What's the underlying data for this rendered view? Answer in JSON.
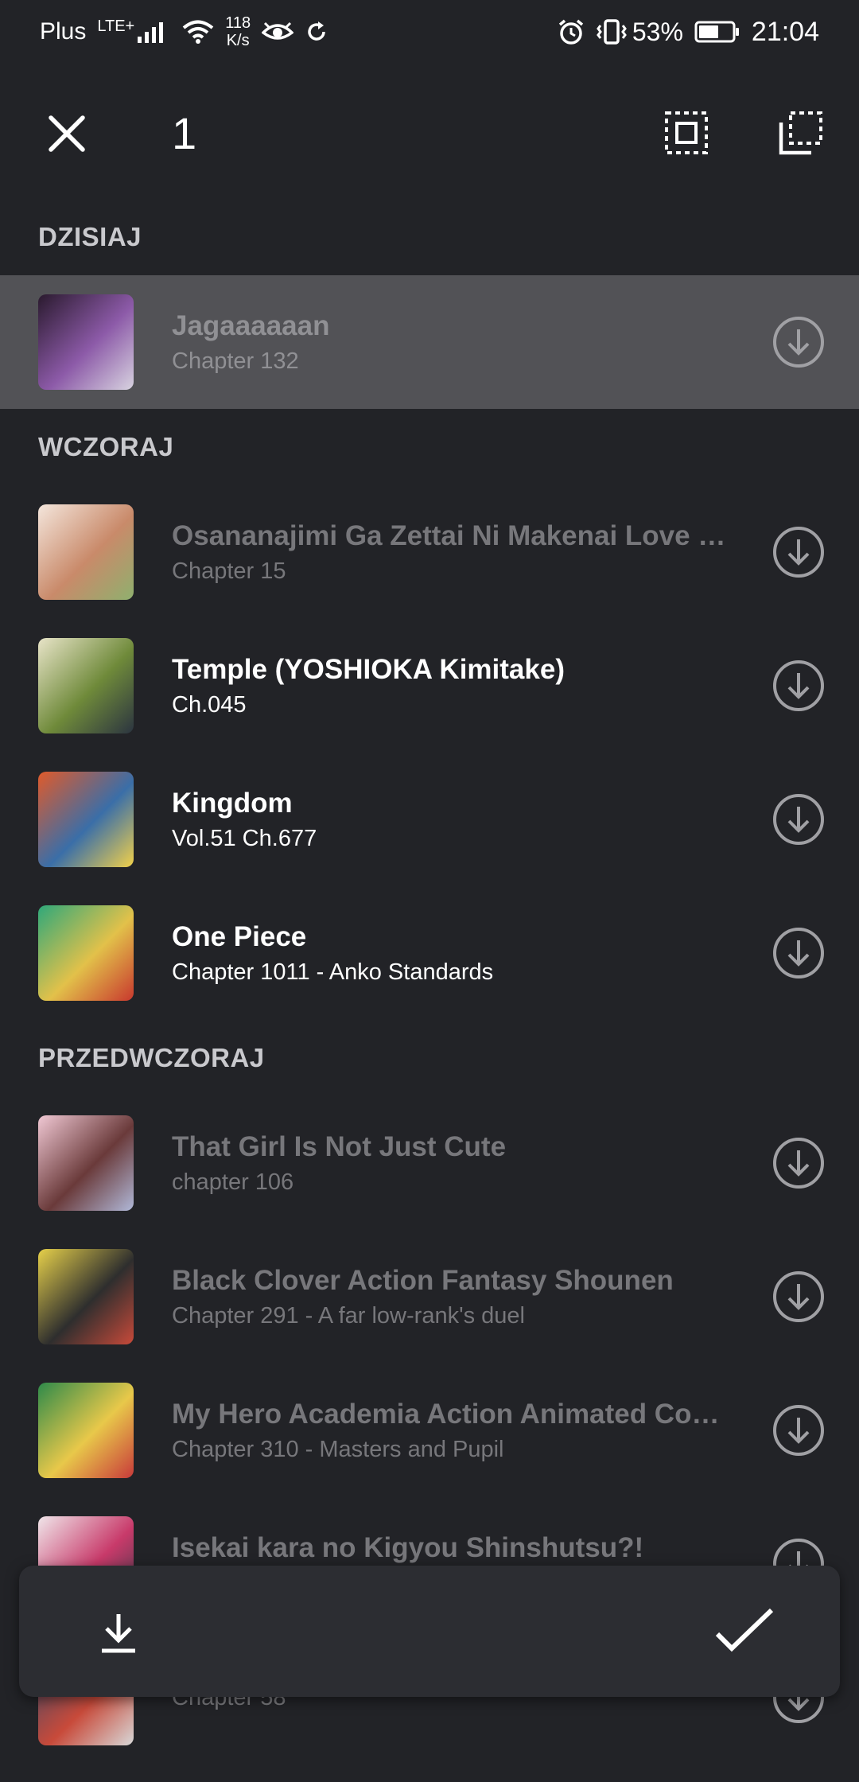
{
  "status_bar": {
    "carrier": "Plus",
    "network": "LTE+",
    "net_speed_value": "118",
    "net_speed_unit": "K/s",
    "battery_percent": "53%",
    "time": "21:04",
    "icons": [
      "signal-icon",
      "wifi-icon",
      "eye-icon",
      "sync-icon",
      "alarm-icon",
      "vibrate-icon",
      "battery-icon"
    ]
  },
  "app_bar": {
    "selected_count": "1",
    "close_icon": "close-icon",
    "select_all_icon": "select-all-icon",
    "select_inverse_icon": "select-inverse-icon"
  },
  "sections": [
    {
      "header": "DZISIAJ",
      "items": [
        {
          "title": "Jagaaaaaan",
          "subtitle": "Chapter 132",
          "state": "selected",
          "thumb_colors": [
            "#2a1a2e",
            "#8c5aa8",
            "#d8d3e0"
          ]
        }
      ]
    },
    {
      "header": "WCZORAJ",
      "items": [
        {
          "title": "Osananajimi Ga Zettai Ni Makenai Love …",
          "subtitle": "Chapter 15",
          "state": "read",
          "thumb_colors": [
            "#f4e6dc",
            "#c98a6a",
            "#8fb06e"
          ]
        },
        {
          "title": "Temple (YOSHIOKA Kimitake)",
          "subtitle": "Ch.045",
          "state": "unread",
          "thumb_colors": [
            "#e8e4c8",
            "#6f8a3a",
            "#2b3440"
          ]
        },
        {
          "title": "Kingdom",
          "subtitle": "Vol.51 Ch.677",
          "state": "unread",
          "thumb_colors": [
            "#e05a2a",
            "#3a6ea8",
            "#f2d14a"
          ]
        },
        {
          "title": "One Piece",
          "subtitle": "Chapter 1011 - Anko Standards",
          "state": "unread",
          "thumb_colors": [
            "#2fa87a",
            "#e2c14a",
            "#c8382e"
          ]
        }
      ]
    },
    {
      "header": "PRZEDWCZORAJ",
      "items": [
        {
          "title": "That Girl Is Not Just Cute",
          "subtitle": "chapter 106",
          "state": "read",
          "thumb_colors": [
            "#f0c8d4",
            "#6a3a3a",
            "#b0b8d8"
          ]
        },
        {
          "title": "Black Clover Action Fantasy Shounen",
          "subtitle": "Chapter 291 - A far low-rank's duel",
          "state": "read",
          "thumb_colors": [
            "#e6d04a",
            "#2e2e2e",
            "#c84a3a"
          ]
        },
        {
          "title": "My Hero Academia Action Animated Com…",
          "subtitle": "Chapter 310 - Masters and Pupil",
          "state": "read",
          "thumb_colors": [
            "#2e8a4a",
            "#e8c84a",
            "#c83a3a"
          ]
        },
        {
          "title": "Isekai kara no Kigyou Shinshutsu?!",
          "subtitle": "",
          "state": "read",
          "thumb_colors": [
            "#f0e6ea",
            "#c83a6a",
            "#3a3a4a"
          ]
        },
        {
          "title": "",
          "subtitle": "Chapter 58",
          "state": "read",
          "thumb_colors": [
            "#3a4a6a",
            "#c84a3a",
            "#d8d8d8"
          ]
        }
      ]
    }
  ],
  "action_bar": {
    "download_icon": "download-icon",
    "mark_read_icon": "checkmark-icon"
  },
  "colors": {
    "background": "#222327",
    "selected_row": "#525256",
    "read_text": "#77777b",
    "section_header": "#c9c9cd",
    "action_bar": "#2c2d32"
  }
}
